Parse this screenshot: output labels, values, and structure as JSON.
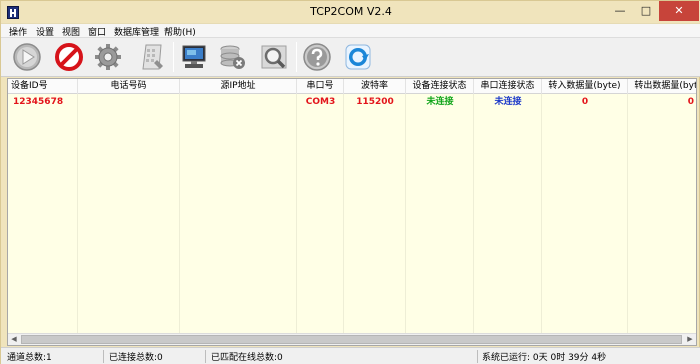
{
  "window": {
    "title": "TCP2COM V2.4",
    "controls": {
      "minimize": "—",
      "maximize": "□",
      "close": "✕"
    }
  },
  "menu": {
    "items": [
      "操作",
      "设置",
      "视图",
      "窗口",
      "数据库管理",
      "帮助(H)"
    ]
  },
  "toolbar": {
    "buttons": [
      {
        "icon": "play-icon"
      },
      {
        "icon": "stop-icon"
      },
      {
        "icon": "settings-gear-icon"
      },
      {
        "icon": "edit-document-icon"
      },
      {
        "icon": "monitor-icon"
      },
      {
        "icon": "database-delete-icon"
      },
      {
        "icon": "search-magnifier-icon"
      },
      {
        "icon": "help-icon"
      },
      {
        "icon": "refresh-icon"
      }
    ]
  },
  "table": {
    "columns": [
      "设备ID号",
      "电话号码",
      "源IP地址",
      "串口号",
      "波特率",
      "设备连接状态",
      "串口连接状态",
      "转入数据量(byte)",
      "转出数据量(byte)"
    ],
    "rows": [
      {
        "device_id": "12345678",
        "phone": "",
        "source_ip": "",
        "com_port": "COM3",
        "baud_rate": "115200",
        "device_status": "未连接",
        "serial_status": "未连接",
        "bytes_in": "0",
        "bytes_out": "0"
      }
    ]
  },
  "colors": {
    "red_text": "#e3141b",
    "green_text": "#11a51a",
    "blue_text": "#1c39c9",
    "table_bg": "#ffffe6",
    "chrome_bg": "#f0e4bc"
  },
  "status": {
    "total_channels": "通道总数:1",
    "connected_total": "已连接总数:0",
    "matched_online": "已匹配在线总数:0",
    "runtime": "系统已运行: 0天  0时 39分 4秒"
  }
}
